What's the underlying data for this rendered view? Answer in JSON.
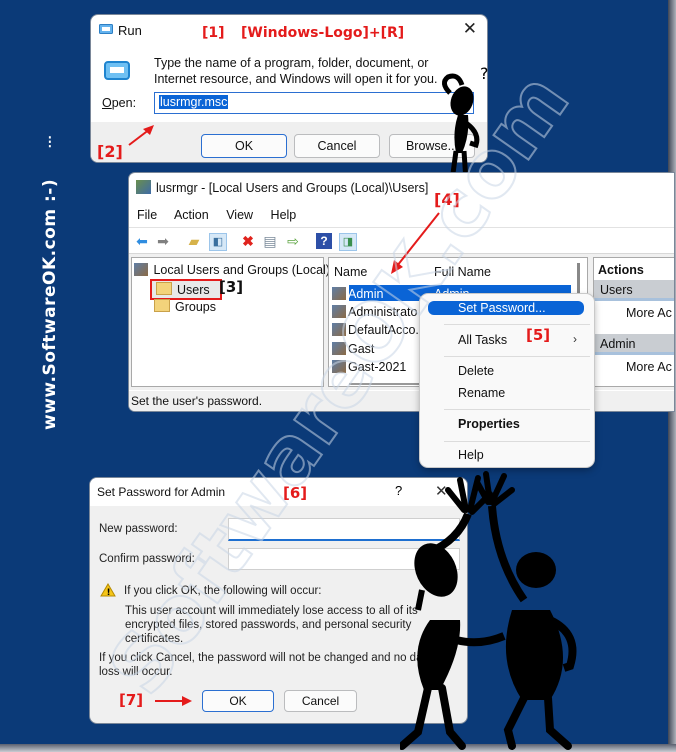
{
  "site_watermark": "www.SoftwareOK.com :-)",
  "annotations": {
    "step1": "[1]",
    "shortcut": "[Windows-Logo]+[R]",
    "step2": "[2]",
    "step3": "[3]",
    "step4": "[4]",
    "step5": "[5]",
    "step6": "[6]",
    "step7": "[7]"
  },
  "run_dialog": {
    "title": "Run",
    "description": "Type the name of a program, folder, document, or Internet resource, and Windows will open it for you.",
    "open_label": "Open:",
    "open_value": "lusrmgr.msc",
    "ok_label": "OK",
    "cancel_label": "Cancel",
    "browse_label": "Browse..."
  },
  "lusrmgr": {
    "title": "lusrmgr - [Local Users and Groups (Local)\\Users]",
    "menu": [
      "File",
      "Action",
      "View",
      "Help"
    ],
    "toolbar_icons": [
      "back-arrow-icon",
      "forward-arrow-icon",
      "up-folder-icon",
      "show-hide-tree-icon",
      "delete-icon",
      "properties-icon",
      "export-list-icon",
      "help-icon",
      "show-hide-action-pane-icon"
    ],
    "tree": {
      "root": "Local Users and Groups (Local)",
      "children": [
        "Users",
        "Groups"
      ]
    },
    "columns": [
      "Name",
      "Full Name"
    ],
    "users": [
      {
        "name": "Admin",
        "full_name": "Admin",
        "selected": true
      },
      {
        "name": "Administrato",
        "full_name": ""
      },
      {
        "name": "DefaultAcco...",
        "full_name": ""
      },
      {
        "name": "Gast",
        "full_name": ""
      },
      {
        "name": "Gast-2021",
        "full_name": ""
      }
    ],
    "actions_pane": {
      "header": "Actions",
      "sections": [
        {
          "title": "Users",
          "item": "More Ac"
        },
        {
          "title": "Admin",
          "item": "More Ac"
        }
      ]
    },
    "status_text": "Set the user's password."
  },
  "context_menu": {
    "items": [
      {
        "label": "Set Password...",
        "highlighted": true
      },
      {
        "label": "All Tasks",
        "submenu": true
      },
      {
        "label": "Delete"
      },
      {
        "label": "Rename"
      },
      {
        "label": "Properties",
        "bold": true
      },
      {
        "label": "Help"
      }
    ]
  },
  "set_password_dialog": {
    "title": "Set Password for Admin",
    "help_glyph": "?",
    "new_password_label": "New password:",
    "confirm_password_label": "Confirm password:",
    "new_password_value": "",
    "confirm_password_value": "",
    "warning_heading": "If you click OK, the following will occur:",
    "warning_body": "This user account will immediately lose access to all of its encrypted files, stored passwords, and personal security certificates.",
    "cancel_note": "If you click Cancel, the password will not be changed and no data loss will occur.",
    "ok_label": "OK",
    "cancel_label": "Cancel"
  },
  "colors": {
    "background": "#0b3a78",
    "annotation_red": "#e41b1b",
    "selection_blue": "#0a64d6"
  }
}
